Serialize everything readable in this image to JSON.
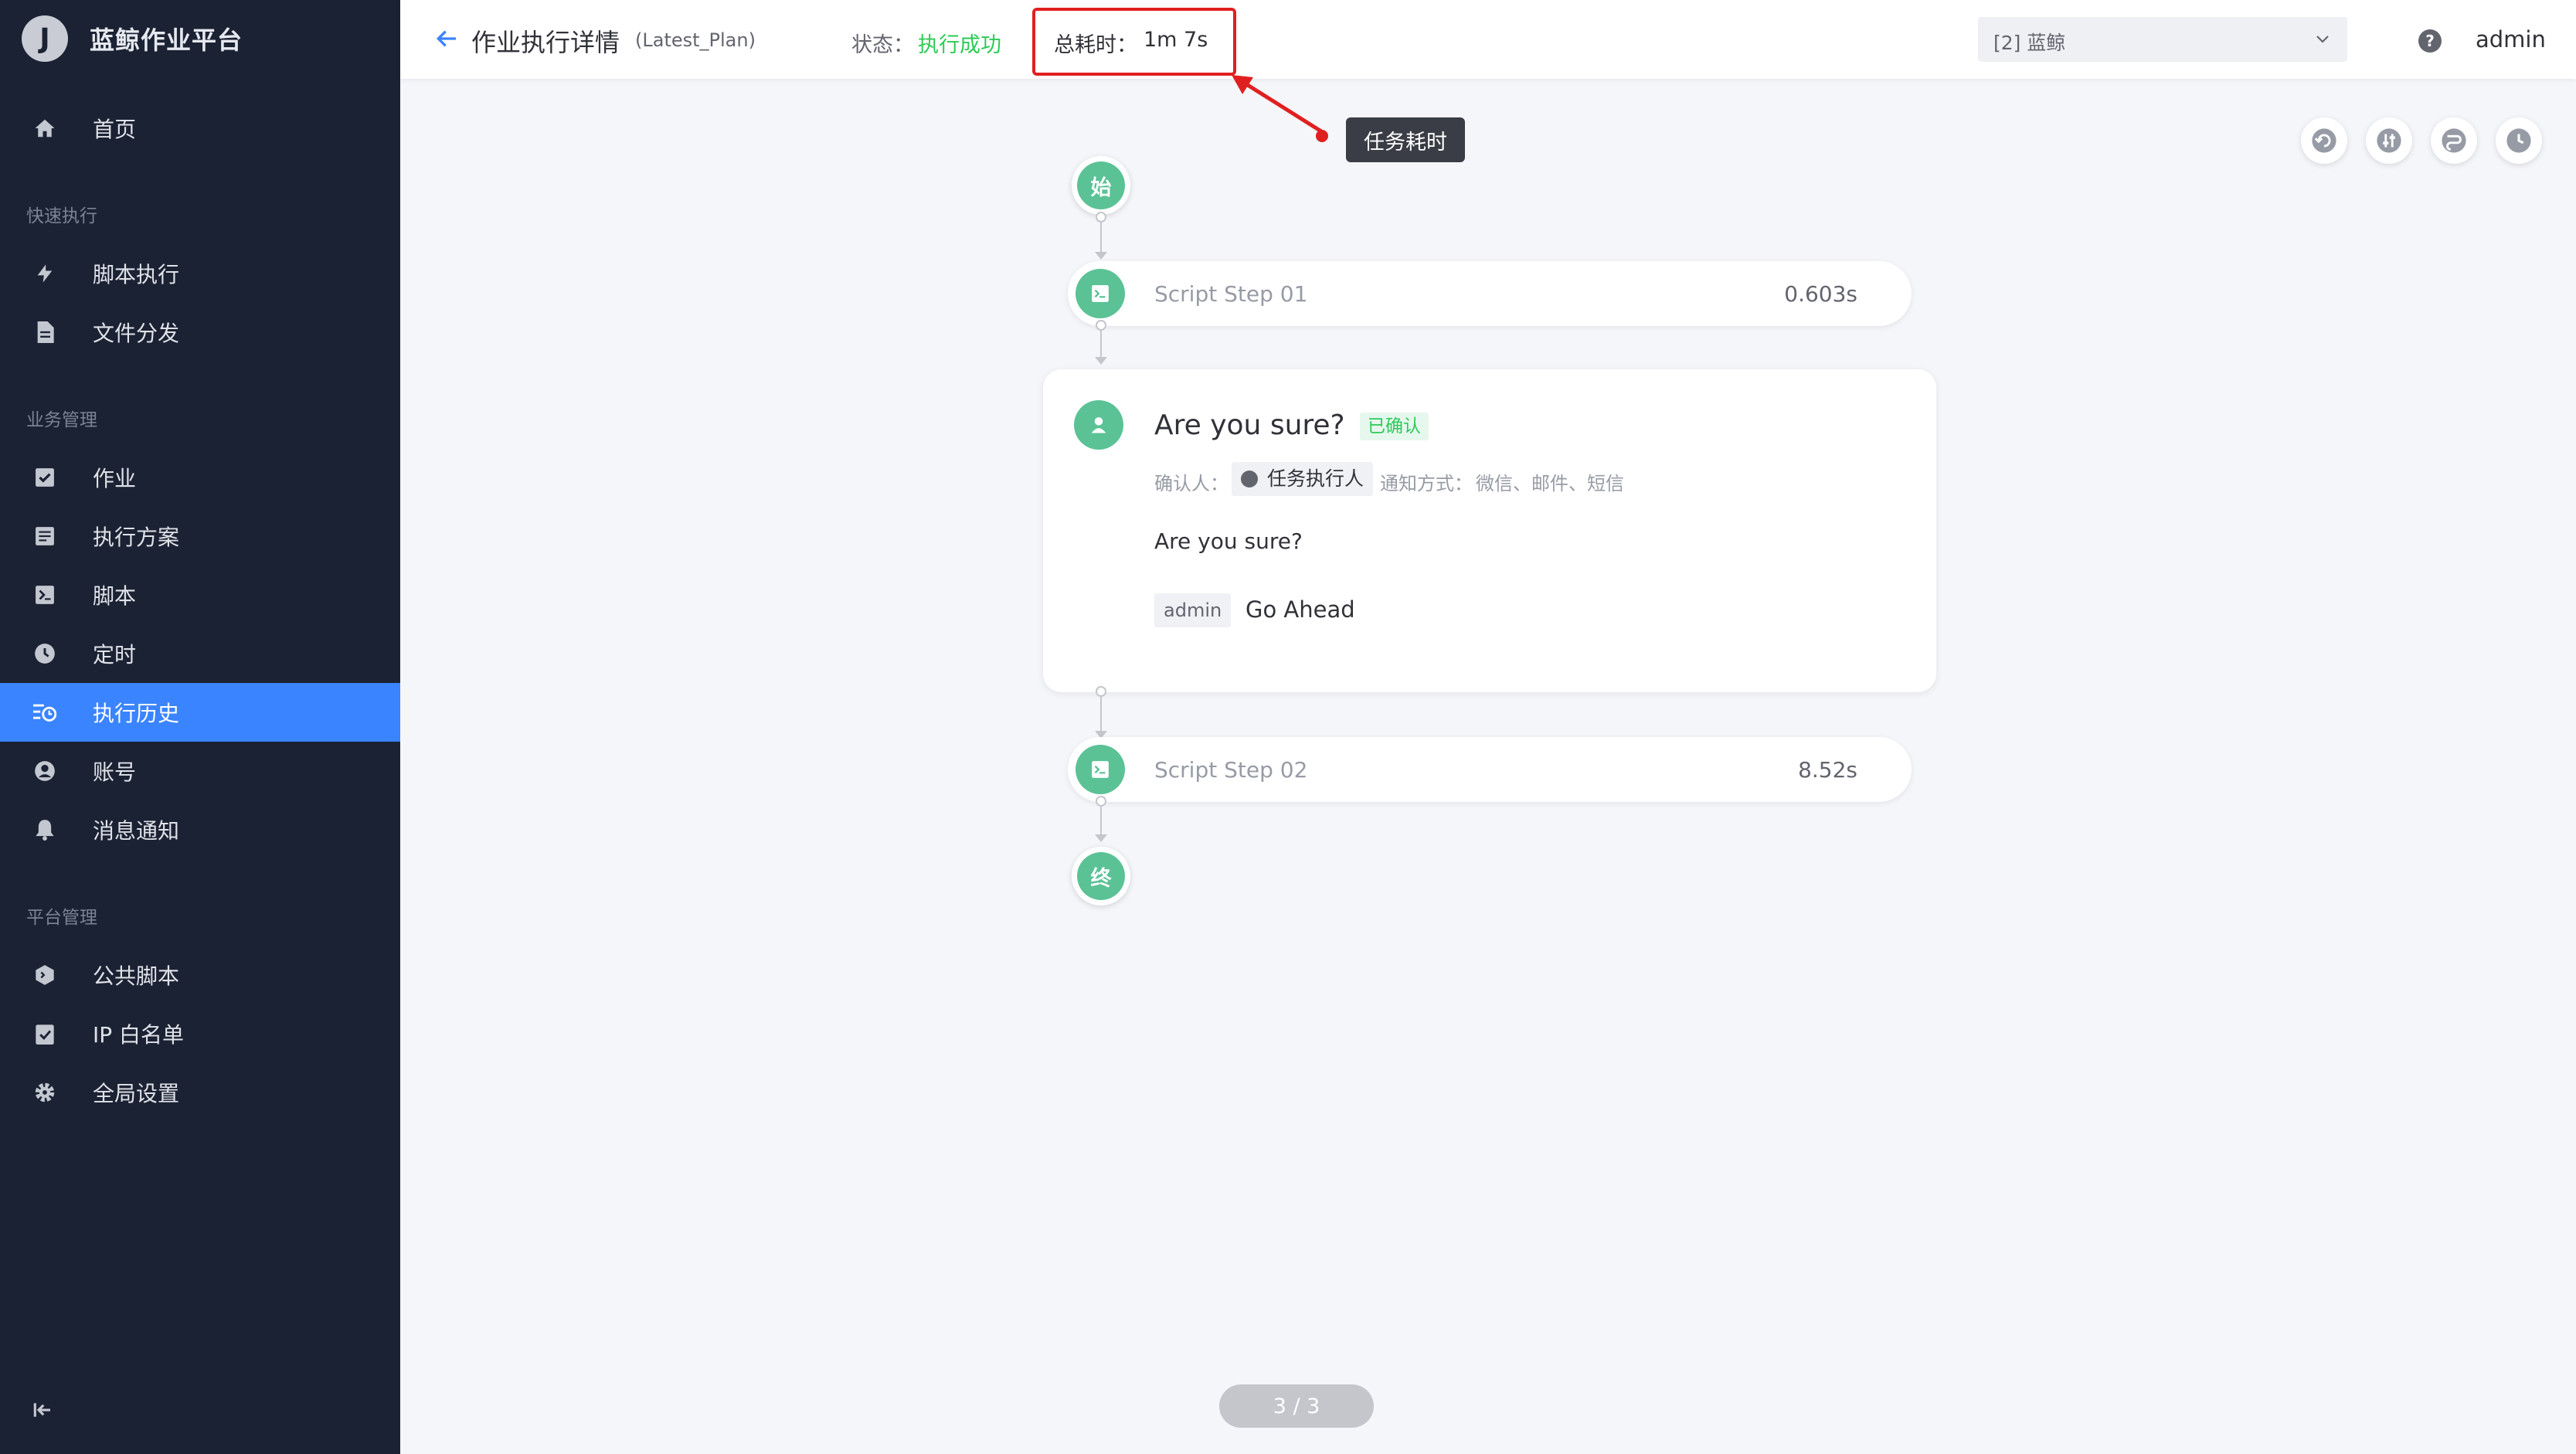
{
  "app": {
    "title": "蓝鲸作业平台",
    "logo_letter": "J"
  },
  "sidebar": {
    "items": [
      {
        "label": "首页",
        "icon": "home-icon"
      },
      {
        "label": "脚本执行",
        "icon": "lightning-icon"
      },
      {
        "label": "文件分发",
        "icon": "file-icon"
      },
      {
        "label": "作业",
        "icon": "job-icon"
      },
      {
        "label": "执行方案",
        "icon": "plan-icon"
      },
      {
        "label": "脚本",
        "icon": "script-icon"
      },
      {
        "label": "定时",
        "icon": "clock-icon"
      },
      {
        "label": "执行历史",
        "icon": "history-icon",
        "active": true
      },
      {
        "label": "账号",
        "icon": "account-icon"
      },
      {
        "label": "消息通知",
        "icon": "bell-icon"
      },
      {
        "label": "公共脚本",
        "icon": "public-script-icon"
      },
      {
        "label": "IP 白名单",
        "icon": "whitelist-icon"
      },
      {
        "label": "全局设置",
        "icon": "gear-icon"
      }
    ],
    "groups": [
      "快速执行",
      "业务管理",
      "平台管理"
    ]
  },
  "header": {
    "title": "作业执行详情",
    "subtitle": "(Latest_Plan)",
    "status_label": "状态：",
    "status_value": "执行成功",
    "time_label": "总耗时：",
    "time_value": "1m 7s",
    "business": "[2] 蓝鲸",
    "help": "?",
    "user": "admin"
  },
  "annotation": {
    "tooltip": "任务耗时"
  },
  "tools": [
    "rollback-icon",
    "adjust-icon",
    "route-icon",
    "history-clock-icon"
  ],
  "flow": {
    "start": "始",
    "end": "终",
    "steps": [
      {
        "name": "Script Step 01",
        "time": "0.603s"
      },
      {
        "name": "Script Step 02",
        "time": "8.52s"
      }
    ],
    "confirm": {
      "title": "Are you sure?",
      "badge": "已确认",
      "confirmer_label": "确认人：",
      "confirmer": "任务执行人",
      "notify_label": "通知方式：",
      "notify_value": "微信、邮件、短信",
      "description": "Are you sure?",
      "reply_user": "admin",
      "reply_text": "Go Ahead"
    }
  },
  "pager": "3 / 3",
  "colors": {
    "accent": "#3a84ff",
    "success": "#2dcb56",
    "node": "#5bc296",
    "sidebar": "#1b2233",
    "highlight": "#e02020"
  }
}
